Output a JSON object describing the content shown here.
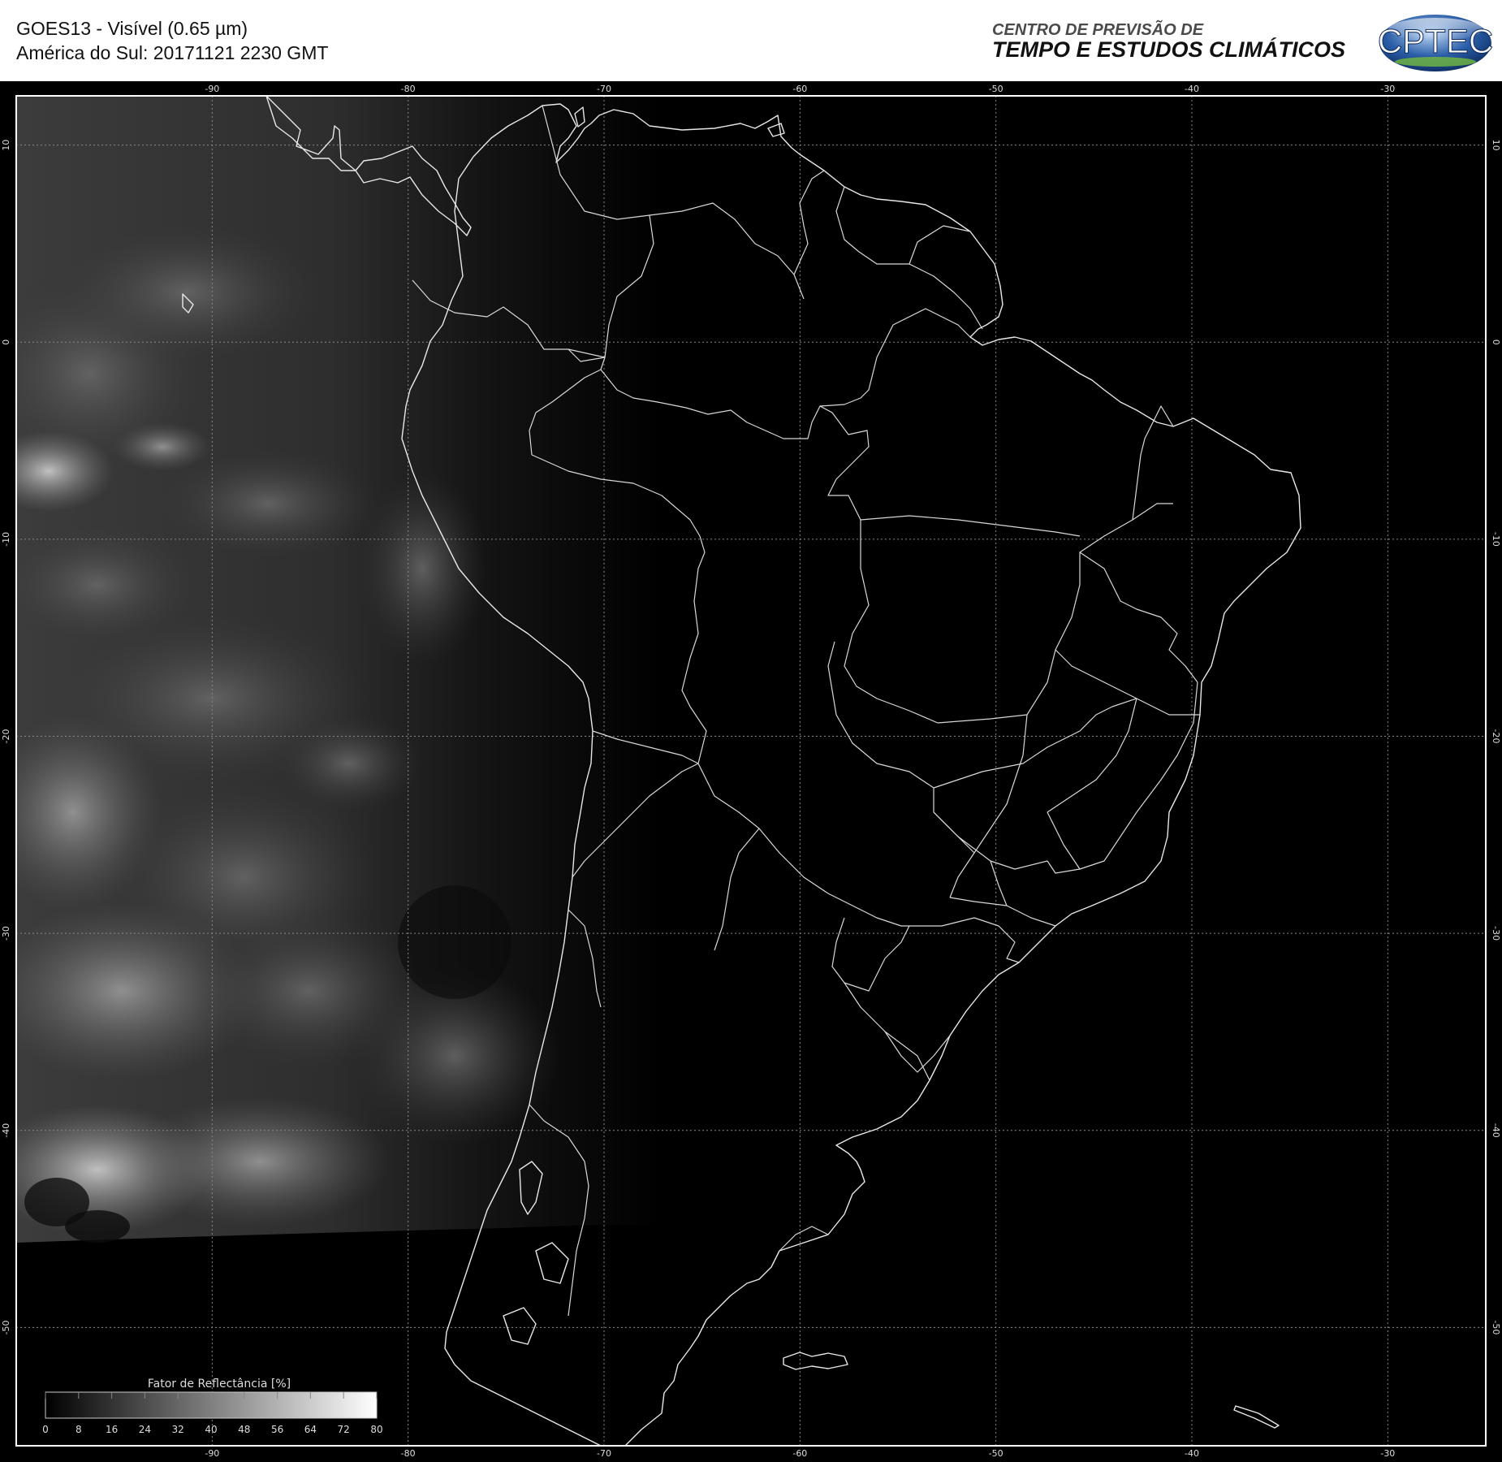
{
  "header": {
    "title": "GOES13 - Visível (0.65 µm)",
    "subtitle": "América do Sul: 20171121 2230 GMT",
    "org_line1": "CENTRO DE PREVISÃO DE",
    "org_line2": "TEMPO E ESTUDOS CLIMÁTICOS",
    "logo_text": "CPTEC"
  },
  "map": {
    "lon_ticks": [
      "-90",
      "-80",
      "-70",
      "-60",
      "-50",
      "-40",
      "-30"
    ],
    "lat_ticks": [
      "10",
      "0",
      "-10",
      "-20",
      "-30",
      "-40",
      "-50"
    ],
    "lon_range": [
      -100,
      -25
    ],
    "lat_range": [
      12.5,
      -56
    ],
    "grid": true,
    "grid_style": "dotted"
  },
  "legend": {
    "title": "Fator de Reflectância [%]",
    "ticks": [
      "0",
      "8",
      "16",
      "24",
      "32",
      "40",
      "48",
      "56",
      "64",
      "72",
      "80"
    ],
    "range": [
      0,
      80
    ]
  },
  "colors": {
    "background": "#000000",
    "frame": "#ffffff",
    "coastline": "#e8e8e8",
    "grid": "#888888",
    "logo_blue": "#2a5da8"
  }
}
